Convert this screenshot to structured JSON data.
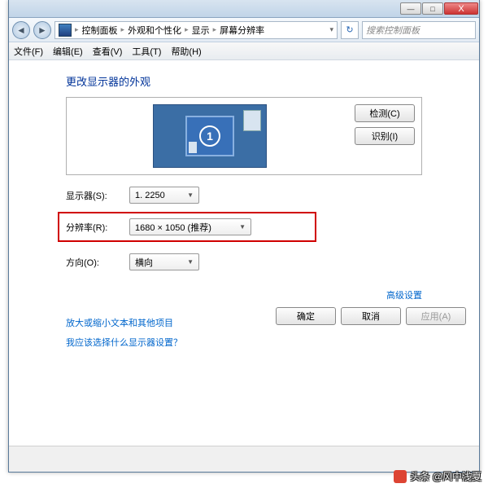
{
  "titlebar": {
    "minimize": "—",
    "maximize": "□",
    "close": "X"
  },
  "nav": {
    "back": "◄",
    "forward": "►",
    "refresh": "↻"
  },
  "breadcrumb": {
    "items": [
      "控制面板",
      "外观和个性化",
      "显示",
      "屏幕分辨率"
    ],
    "sep": "▸"
  },
  "search": {
    "placeholder": "搜索控制面板"
  },
  "menubar": {
    "file": "文件(F)",
    "edit": "编辑(E)",
    "view": "查看(V)",
    "tools": "工具(T)",
    "help": "帮助(H)"
  },
  "heading": "更改显示器的外观",
  "monitor_preview": {
    "main_number": "1"
  },
  "buttons": {
    "detect": "检测(C)",
    "identify": "识别(I)",
    "ok": "确定",
    "cancel": "取消",
    "apply": "应用(A)"
  },
  "form": {
    "display_label": "显示器(S):",
    "display_value": "1. 2250",
    "resolution_label": "分辨率(R):",
    "resolution_value": "1680 × 1050 (推荐)",
    "orientation_label": "方向(O):",
    "orientation_value": "横向"
  },
  "links": {
    "advanced": "高级设置",
    "text_size": "放大或缩小文本和其他项目",
    "which_settings": "我应该选择什么显示器设置？"
  },
  "watermark": {
    "text": "头条 @风中浅夏"
  }
}
